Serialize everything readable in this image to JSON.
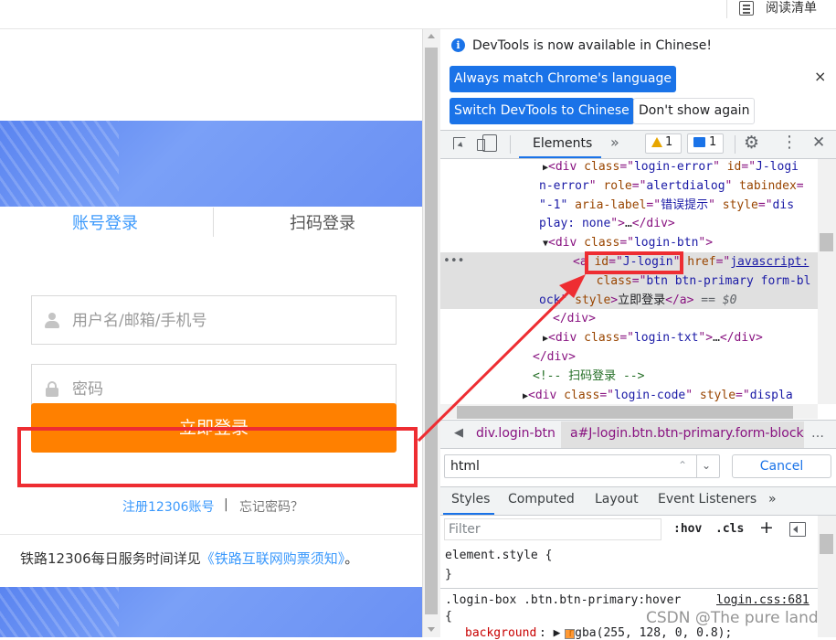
{
  "topbar": {
    "reading_list": "阅读清单"
  },
  "login": {
    "tab_account": "账号登录",
    "tab_qr": "扫码登录",
    "username_placeholder": "用户名/邮箱/手机号",
    "password_placeholder": "密码",
    "login_button": "立即登录",
    "register_link": "注册12306账号",
    "link_separator": "|",
    "forgot_link": "忘记密码？",
    "service_text": "铁路12306每日服务时间详见",
    "service_link": "《铁路互联网购票须知》",
    "service_end": "。"
  },
  "devtools": {
    "banner": {
      "info_icon": "i",
      "message": "DevTools is now available in Chinese!",
      "match_button": "Always match Chrome's language",
      "switch_button": "Switch DevTools to Chinese",
      "dont_show_button": "Don't show again",
      "close": "×"
    },
    "toolbar": {
      "elements_tab": "Elements",
      "more_tabs": "»",
      "warning_count": "1",
      "message_count": "1",
      "settings": "⚙",
      "menu": "⋮",
      "close": "✕"
    },
    "tree": {
      "row_dots": "•••",
      "lines": [
        {
          "indent": "      ",
          "arrow": "▶",
          "parts": [
            [
              "tg",
              "<div "
            ],
            [
              "at",
              "class"
            ],
            [
              "tg",
              "=\""
            ],
            [
              "av",
              "login-error"
            ],
            [
              "tg",
              "\" "
            ],
            [
              "at",
              "id"
            ],
            [
              "tg",
              "=\""
            ],
            [
              "av",
              "J-logi"
            ]
          ]
        },
        {
          "indent": "",
          "arrow": "",
          "parts": [
            [
              "av",
              "n-error"
            ],
            [
              "tg",
              "\" "
            ],
            [
              "at",
              "role"
            ],
            [
              "tg",
              "=\""
            ],
            [
              "av",
              "alertdialog"
            ],
            [
              "tg",
              "\" "
            ],
            [
              "at",
              "tabindex"
            ],
            [
              "tg",
              "="
            ]
          ]
        },
        {
          "indent": "",
          "arrow": "",
          "parts": [
            [
              "av",
              "\"-1\" "
            ],
            [
              "at",
              "aria-label"
            ],
            [
              "tg",
              "=\""
            ],
            [
              "av",
              "错误提示"
            ],
            [
              "tg",
              "\" "
            ],
            [
              "at",
              "style"
            ],
            [
              "tg",
              "=\""
            ],
            [
              "av",
              "dis"
            ]
          ]
        },
        {
          "indent": "",
          "arrow": "",
          "parts": [
            [
              "av",
              "play: none"
            ],
            [
              "tg",
              "\">"
            ],
            [
              "tx",
              "…"
            ],
            [
              "tg",
              "</div>"
            ]
          ]
        },
        {
          "indent": "      ",
          "arrow": "▼",
          "parts": [
            [
              "tg",
              "<div "
            ],
            [
              "at",
              "class"
            ],
            [
              "tg",
              "=\""
            ],
            [
              "av",
              "login-btn"
            ],
            [
              "tg",
              "\">"
            ]
          ]
        },
        {
          "indent": "         ",
          "arrow": "",
          "parts": [
            [
              "tg",
              "<a "
            ],
            [
              "at",
              "id"
            ],
            [
              "tg",
              "=\""
            ],
            [
              "av",
              "J-login"
            ],
            [
              "tg",
              "\" "
            ],
            [
              "at",
              "href"
            ],
            [
              "tg",
              "=\""
            ],
            [
              "lk",
              "javascript:"
            ]
          ]
        },
        {
          "indent": "",
          "arrow": "",
          "parts": [
            [
              "tx",
              "       "
            ],
            [
              "tg",
              " "
            ],
            [
              "at",
              "class"
            ],
            [
              "tg",
              "=\""
            ],
            [
              "av",
              "btn btn-primary form-bl"
            ]
          ]
        },
        {
          "indent": "",
          "arrow": "",
          "parts": [
            [
              "av",
              "ock"
            ],
            [
              "tg",
              "\" "
            ],
            [
              "at",
              "style"
            ],
            [
              "tg",
              ">"
            ],
            [
              "tx",
              "立即登录"
            ],
            [
              "tg",
              "</a>"
            ],
            [
              "dim",
              " == $0"
            ]
          ]
        },
        {
          "indent": "       ",
          "arrow": "",
          "parts": [
            [
              "tg",
              "</div>"
            ]
          ]
        },
        {
          "indent": "      ",
          "arrow": "▶",
          "parts": [
            [
              "tg",
              "<div "
            ],
            [
              "at",
              "class"
            ],
            [
              "tg",
              "=\""
            ],
            [
              "av",
              "login-txt"
            ],
            [
              "tg",
              "\">"
            ],
            [
              "tx",
              "…"
            ],
            [
              "tg",
              "</div>"
            ]
          ]
        },
        {
          "indent": "     ",
          "arrow": "",
          "parts": [
            [
              "tg",
              "</div>"
            ]
          ]
        },
        {
          "indent": "     ",
          "arrow": "",
          "parts": [
            [
              "cm",
              "<!-- 扫码登录 -->"
            ]
          ]
        },
        {
          "indent": "    ",
          "arrow": "▶",
          "parts": [
            [
              "tg",
              "<div "
            ],
            [
              "at",
              "class"
            ],
            [
              "tg",
              "=\""
            ],
            [
              "av",
              "login-code"
            ],
            [
              "tg",
              "\" "
            ],
            [
              "at",
              "style"
            ],
            [
              "tg",
              "=\""
            ],
            [
              "av",
              "displa"
            ]
          ]
        }
      ]
    },
    "breadcrumb": {
      "arrow": "◀",
      "item1": "div.login-btn",
      "item2": "a#J-login.btn.btn-primary.form-block",
      "ellipsis": "…"
    },
    "search": {
      "value": "html",
      "up": "⌃",
      "down": "⌄",
      "cancel": "Cancel"
    },
    "styles_tabs": [
      "Styles",
      "Computed",
      "Layout",
      "Event Listeners",
      "»"
    ],
    "filter": {
      "placeholder": "Filter",
      "hov": ":hov",
      "cls": ".cls",
      "plus": "+"
    },
    "styles": {
      "element_style": "element.style {",
      "close_brace": "}",
      "rule_selector": ".login-box .btn.btn-primary:hover",
      "rule_source": "login.css:681",
      "rule_open": "{",
      "prop_name": "background",
      "prop_value": ": ▶ rgba(255, 128, 0, 0.8);"
    }
  },
  "watermark": "CSDN @The pure land",
  "colors": {
    "accent_orange": "#ff8000",
    "annotation_red": "#ee2d32",
    "link_blue": "#3b99fc",
    "devtools_blue": "#1a73e8"
  }
}
